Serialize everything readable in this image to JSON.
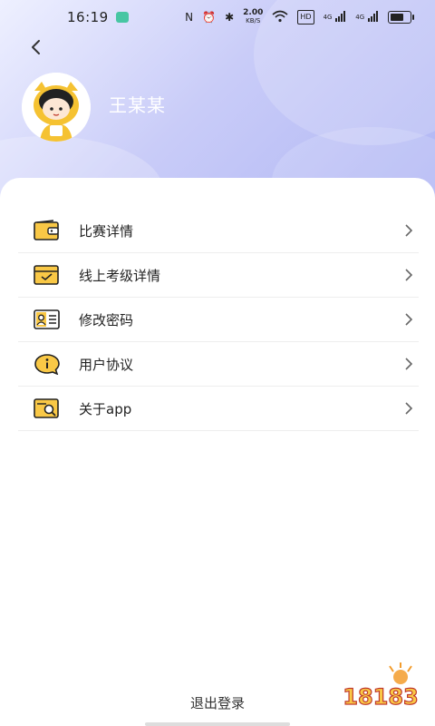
{
  "status_bar": {
    "time": "16:19",
    "network_speed": "2.00",
    "network_unit": "KB/S",
    "hd": "HD",
    "signal1": "4G",
    "signal2": "4G"
  },
  "profile": {
    "name": "王某某"
  },
  "menu": [
    {
      "label": "比赛详情",
      "icon": "wallet-icon"
    },
    {
      "label": "线上考级详情",
      "icon": "inbox-check-icon"
    },
    {
      "label": "修改密码",
      "icon": "id-card-icon"
    },
    {
      "label": "用户协议",
      "icon": "info-chat-icon"
    },
    {
      "label": "关于app",
      "icon": "search-doc-icon"
    }
  ],
  "logout_label": "退出登录",
  "watermark": "18183",
  "colors": {
    "accent": "#f9c846",
    "gradient_end": "#aeb4f4"
  }
}
